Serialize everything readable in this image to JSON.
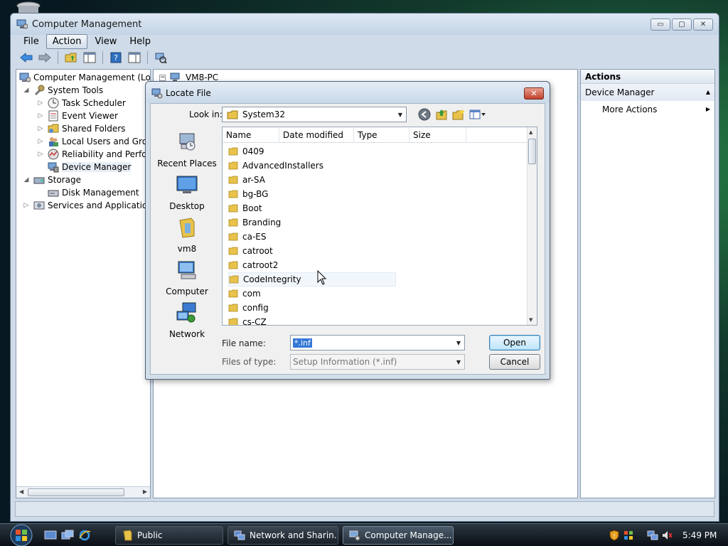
{
  "window": {
    "title": "Computer Management",
    "caption": {
      "minimize": "▭",
      "maximize": "▢",
      "close": "✕"
    }
  },
  "menu": [
    "File",
    "Action",
    "View",
    "Help"
  ],
  "tree": {
    "root": "Computer Management (Local",
    "system_tools": "System Tools",
    "task_scheduler": "Task Scheduler",
    "event_viewer": "Event Viewer",
    "shared_folders": "Shared Folders",
    "local_users": "Local Users and Group",
    "reliability": "Reliability and Perform",
    "device_manager": "Device Manager",
    "storage": "Storage",
    "disk_management": "Disk Management",
    "services": "Services and Applications"
  },
  "middle": {
    "root": "VM8-PC"
  },
  "actions": {
    "header": "Actions",
    "section": "Device Manager",
    "item": "More Actions"
  },
  "dialog": {
    "title": "Locate File",
    "look_in_label": "Look in:",
    "look_in_value": "System32",
    "columns": [
      "Name",
      "Date modified",
      "Type",
      "Size"
    ],
    "places": [
      "Recent Places",
      "Desktop",
      "vm8",
      "Computer",
      "Network"
    ],
    "files": [
      "0409",
      "AdvancedInstallers",
      "ar-SA",
      "bg-BG",
      "Boot",
      "Branding",
      "ca-ES",
      "catroot",
      "catroot2",
      "CodeIntegrity",
      "com",
      "config",
      "cs-CZ"
    ],
    "file_name_label": "File name:",
    "file_name_value": "*.inf",
    "files_of_type_label": "Files of type:",
    "files_of_type_value": "Setup Information (*.inf)",
    "open_label": "Open",
    "cancel_label": "Cancel",
    "close_glyph": "✕"
  },
  "taskbar": {
    "tasks": [
      "Public",
      "Network and Sharin...",
      "Computer Manage..."
    ],
    "clock": "5:49 PM"
  },
  "colors": {
    "accent": "#3478d6",
    "folder": "#e8c24a",
    "taskbar": "#1a2028"
  }
}
